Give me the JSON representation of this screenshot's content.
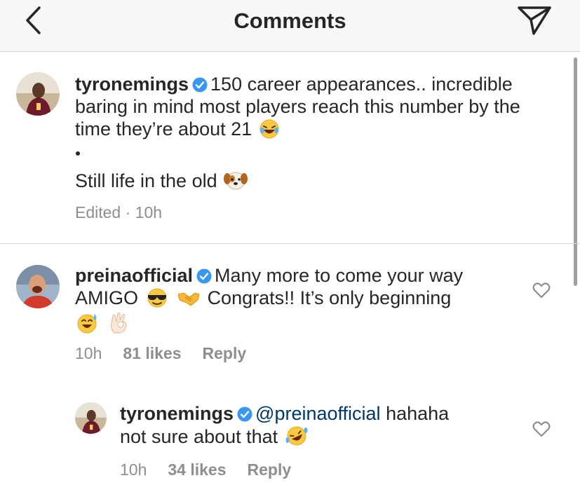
{
  "header": {
    "title": "Comments"
  },
  "caption": {
    "username": "tyronemings",
    "text_line1": "150 career appearances.. incredible",
    "text_line2": "baring in mind most players reach this number by the",
    "text_line3": "time they’re about 21",
    "text_line4": "Still life in the old",
    "meta": "Edited · 10h"
  },
  "comments": [
    {
      "username": "preinaofficial",
      "text_line1": "Many more to come your way",
      "text_line2a": "AMIGO",
      "text_line2b": "Congrats!! It’s only beginning",
      "time": "10h",
      "likes": "81 likes",
      "reply": "Reply"
    },
    {
      "username": "tyronemings",
      "mention": "@preinaofficial",
      "text_line1": "hahaha",
      "text_line2": "not sure about that",
      "time": "10h",
      "likes": "34 likes",
      "reply": "Reply"
    }
  ],
  "colors": {
    "verified": "#3897f0",
    "mention": "#00376b",
    "meta": "#8e8e8e"
  },
  "icons": [
    "back-chevron-icon",
    "send-icon",
    "verified-icon",
    "heart-icon",
    "laughing-emoji-icon",
    "dog-emoji-icon",
    "sunglasses-emoji-icon",
    "handshake-emoji-icon",
    "sweat-smile-emoji-icon",
    "ok-hand-emoji-icon",
    "rofl-emoji-icon"
  ]
}
